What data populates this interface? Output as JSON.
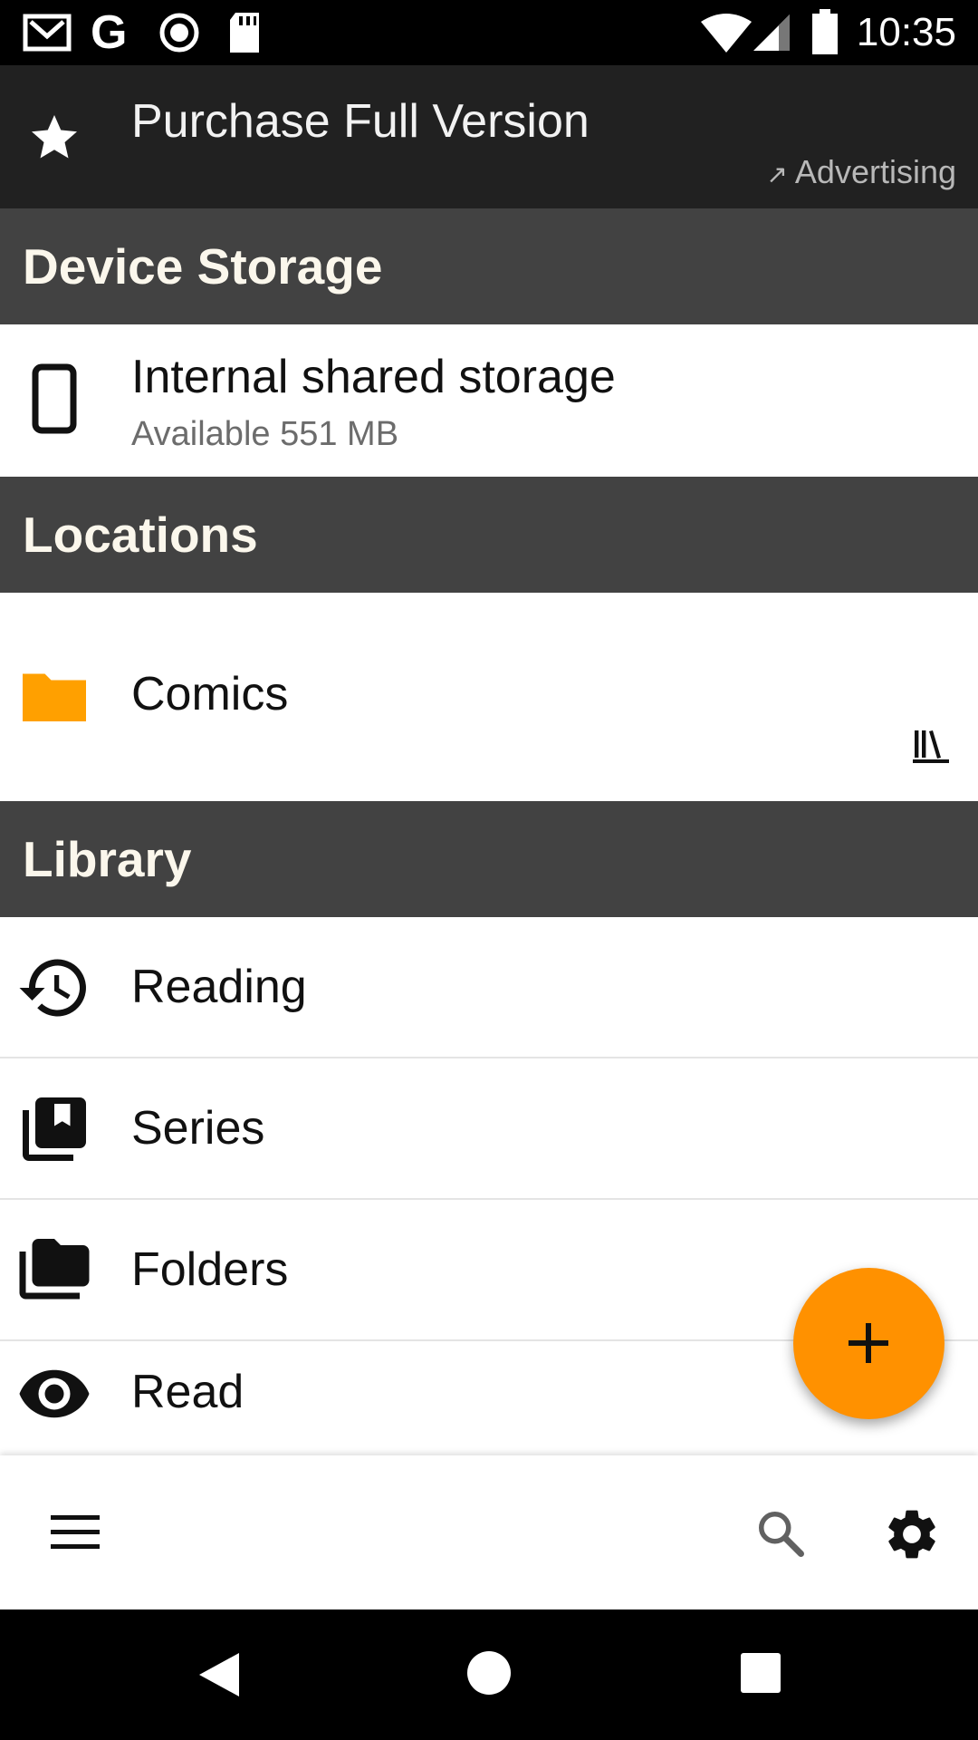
{
  "status_bar": {
    "time": "10:35",
    "icons": [
      "gmail-icon",
      "google-icon",
      "record-icon",
      "sd-card-icon",
      "wifi-icon",
      "cell-signal-icon",
      "battery-icon"
    ]
  },
  "promo": {
    "title": "Purchase Full Version",
    "ad_label": "Advertising",
    "icon": "star-icon"
  },
  "sections": {
    "device_storage": "Device Storage",
    "locations": "Locations",
    "library": "Library"
  },
  "device_storage": {
    "name": "Internal shared storage",
    "available": "Available 551 MB",
    "icon": "phone-icon"
  },
  "locations": {
    "items": [
      {
        "label": "Comics",
        "icon": "folder-icon",
        "action_icon": "library-shelf-icon"
      }
    ]
  },
  "library": {
    "items": [
      {
        "label": "Reading",
        "icon": "history-icon"
      },
      {
        "label": "Series",
        "icon": "series-books-icon"
      },
      {
        "label": "Folders",
        "icon": "folders-icon"
      },
      {
        "label": "Read",
        "icon": "eye-icon"
      }
    ]
  },
  "toolbar": {
    "icons": [
      "menu-icon",
      "search-icon",
      "settings-icon"
    ]
  },
  "fab": {
    "icon": "plus-icon"
  },
  "colors": {
    "accent": "#ff9100",
    "header_bg": "#424242",
    "promo_bg": "#212121",
    "folder": "#ffa000"
  }
}
